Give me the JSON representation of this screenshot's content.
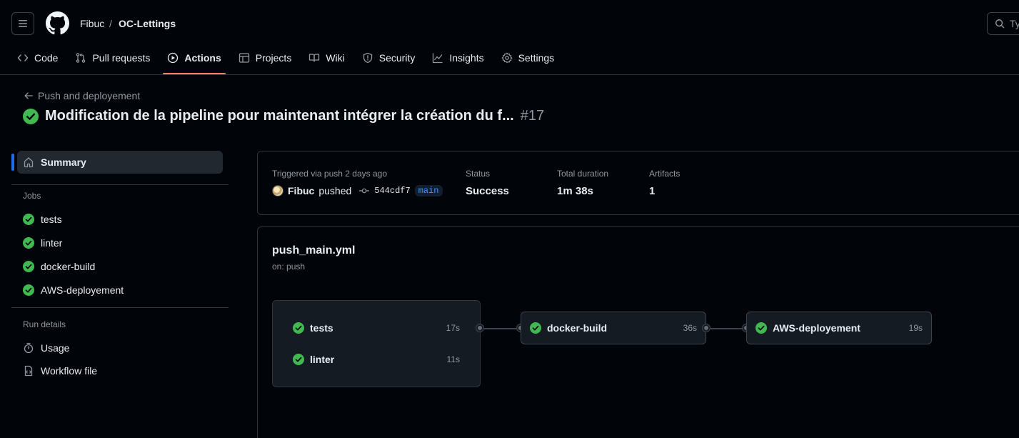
{
  "header": {
    "owner": "Fibuc",
    "separator": "/",
    "repo": "OC-Lettings",
    "search_placeholder": "Ty"
  },
  "tabs": [
    {
      "label": "Code",
      "icon": "code-icon"
    },
    {
      "label": "Pull requests",
      "icon": "pull-request-icon"
    },
    {
      "label": "Actions",
      "icon": "play-icon",
      "active": true
    },
    {
      "label": "Projects",
      "icon": "table-icon"
    },
    {
      "label": "Wiki",
      "icon": "book-icon"
    },
    {
      "label": "Security",
      "icon": "shield-icon"
    },
    {
      "label": "Insights",
      "icon": "graph-icon"
    },
    {
      "label": "Settings",
      "icon": "gear-icon"
    }
  ],
  "run": {
    "back_label": "Push and deployement",
    "title": "Modification de la pipeline pour maintenant intégrer la création du f...",
    "number": "#17"
  },
  "sidebar": {
    "summary_label": "Summary",
    "jobs_heading": "Jobs",
    "jobs": [
      "tests",
      "linter",
      "docker-build",
      "AWS-deployement"
    ],
    "run_details_heading": "Run details",
    "details": [
      {
        "label": "Usage",
        "icon": "stopwatch-icon"
      },
      {
        "label": "Workflow file",
        "icon": "file-code-icon"
      }
    ]
  },
  "summary": {
    "trigger_label": "Triggered via push 2 days ago",
    "actor": "Fibuc",
    "action": "pushed",
    "commit": "544cdf7",
    "branch": "main",
    "status_label": "Status",
    "status_value": "Success",
    "duration_label": "Total duration",
    "duration_value": "1m 38s",
    "artifacts_label": "Artifacts",
    "artifacts_value": "1"
  },
  "workflow": {
    "file": "push_main.yml",
    "trigger": "on: push",
    "jobs": {
      "tests": {
        "name": "tests",
        "duration": "17s"
      },
      "linter": {
        "name": "linter",
        "duration": "11s"
      },
      "docker": {
        "name": "docker-build",
        "duration": "36s"
      },
      "aws": {
        "name": "AWS-deployement",
        "duration": "19s"
      }
    }
  },
  "colors": {
    "success": "#3fb950",
    "accent_tab": "#f78166",
    "accent_sidebar": "#1f6feb"
  }
}
